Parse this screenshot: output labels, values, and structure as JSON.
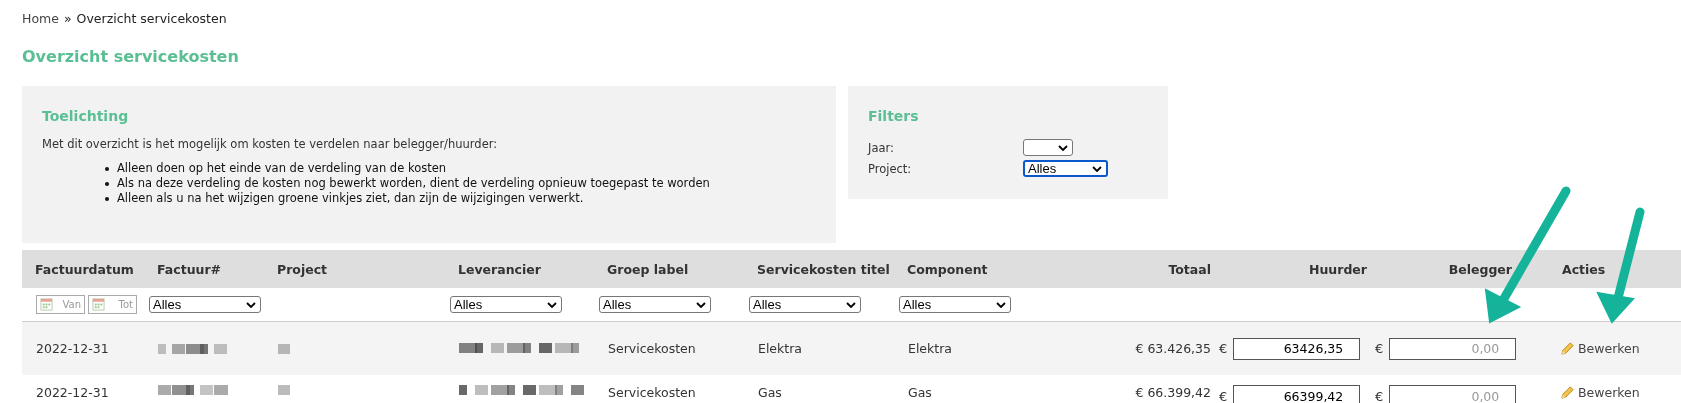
{
  "breadcrumb": {
    "home": "Home",
    "separator": "»",
    "current": "Overzicht servicekosten"
  },
  "title": "Overzicht servicekosten",
  "explanation": {
    "title": "Toelichting",
    "intro": "Met dit overzicht is het mogelijk om kosten te verdelen naar belegger/huurder:",
    "bullets": [
      "Alleen doen op het einde van de verdeling van de kosten",
      "Als na deze verdeling de kosten nog bewerkt worden, dient de verdeling opnieuw toegepast te worden",
      "Alleen als u na het wijzigen groene vinkjes ziet, dan zijn de wijzigingen verwerkt."
    ]
  },
  "filters": {
    "title": "Filters",
    "fields": [
      {
        "label": "Jaar:",
        "focused": false
      },
      {
        "label": "Project:",
        "value": "Alles",
        "focused": true
      }
    ]
  },
  "table": {
    "columns": [
      "Factuurdatum",
      "Factuur#",
      "Project",
      "Leverancier",
      "Groep label",
      "Servicekosten titel",
      "Component",
      "Totaal",
      "Huurder",
      "Belegger",
      "Acties"
    ],
    "date_filters": [
      "Van",
      "Tot"
    ],
    "column_filters": {
      "invoice": "Alles",
      "supplier": "Alles",
      "group": "Alles",
      "title": "Alles",
      "component": "Alles"
    },
    "rows": [
      {
        "date": "2022-12-31",
        "group": "Servicekosten",
        "title": "Elektra",
        "component": "Elektra",
        "total": "€ 63.426,35",
        "currency_tenant": "€",
        "tenant": "63426,35",
        "currency_investor": "€",
        "investor_placeholder": "0,00",
        "action": "Bewerken"
      },
      {
        "date": "2022-12-31",
        "group": "Servicekosten",
        "title": "Gas",
        "component": "Gas",
        "total": "€ 66.399,42",
        "currency_tenant": "€",
        "tenant": "66399,42",
        "currency_investor": "€",
        "investor_placeholder": "0,00",
        "action": "Bewerken"
      }
    ]
  }
}
